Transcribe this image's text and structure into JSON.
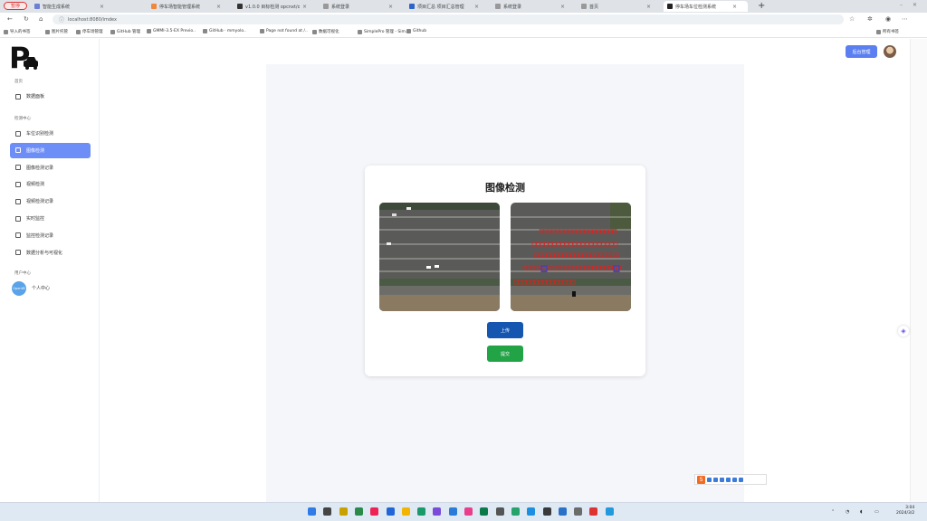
{
  "browser": {
    "pause_label": "暂停",
    "tabs": [
      {
        "title": "智能生成系统",
        "color": "#6b7fd7"
      },
      {
        "title": "停车场智能管理系统",
        "color": "#f1873a"
      },
      {
        "title": "v1.0.0 目标检测 opcnxt/opcnxt",
        "color": "#333333"
      },
      {
        "title": "系统登录",
        "color": "#999999"
      },
      {
        "title": "项目汇总 项目汇总管理",
        "color": "#2c64c9"
      },
      {
        "title": "系统登录",
        "color": "#999999"
      },
      {
        "title": "首页",
        "color": "#999999"
      },
      {
        "title": "停车场车位检测系统",
        "color": "#222222"
      }
    ],
    "url": "localhost:8080/imdex",
    "bookmarks": [
      "导入的书签",
      "图片托管",
      "停车场管理",
      "GitHub 管理",
      "GMMI-3.5-EX Previo..",
      "GitHub · mmyolo..",
      "Page not found at /..",
      "数据可视化",
      "SimplePro 管理 - Sim..",
      "Github"
    ],
    "bookmarks_right": "所有书签"
  },
  "sidebar": {
    "sections": [
      {
        "title": "首页",
        "items": [
          {
            "label": "数据面板",
            "active": false
          }
        ]
      },
      {
        "title": "检测中心",
        "items": [
          {
            "label": "车位识别检测",
            "active": false
          },
          {
            "label": "图像检测",
            "active": true
          },
          {
            "label": "图像检测记录",
            "active": false
          },
          {
            "label": "视频检测",
            "active": false
          },
          {
            "label": "视频检测记录",
            "active": false
          },
          {
            "label": "实时监控",
            "active": false
          },
          {
            "label": "监控检测记录",
            "active": false
          },
          {
            "label": "数据分析与可视化",
            "active": false
          }
        ]
      },
      {
        "title": "用户中心",
        "items": [
          {
            "label": "个人中心",
            "active": false
          }
        ]
      }
    ],
    "avatar_text": "OpenIM"
  },
  "header": {
    "button_label": "后台管理"
  },
  "card": {
    "title": "图像检测",
    "upload_label": "上传",
    "submit_label": "提交"
  },
  "taskbar": {
    "clock_time": "3:04",
    "clock_date": "2024/3/2"
  },
  "colors": {
    "accent": "#6d8ef7",
    "upload": "#1456b0",
    "submit": "#21a346",
    "detect_box": "#e02020",
    "detect_box_alt": "#3a3ae0"
  }
}
